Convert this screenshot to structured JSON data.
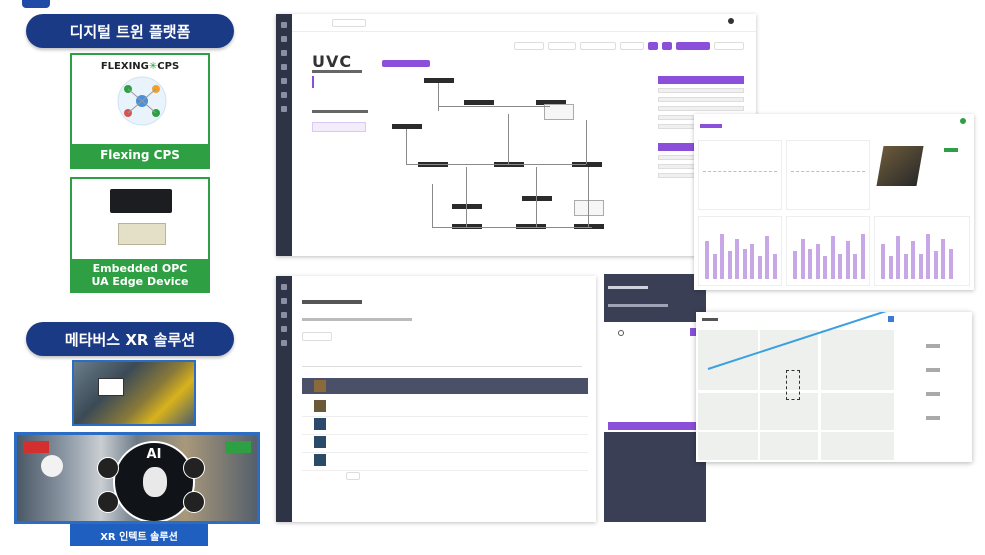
{
  "left": {
    "digital_twin_title": "디지털 트윈 플랫폼",
    "cps_logo_text": "FLEXING",
    "cps_logo_suffix": "CPS",
    "cps_caption": "Flexing CPS",
    "edge_caption_line1": "Embedded OPC",
    "edge_caption_line2": "UA Edge  Device",
    "metaverse_title": "메타버스 XR 솔루션",
    "xr_ai_label": "AI",
    "xr_caption": "XR 인텍트 솔루션"
  },
  "dashboard1": {
    "logo": "UVC"
  },
  "chart_window": {
    "bar_heights": [
      0.75,
      0.5,
      0.9,
      0.55,
      0.8,
      0.6,
      0.7,
      0.45,
      0.85,
      0.5
    ],
    "colors": {
      "bar": "#c8a7e6",
      "accent": "#8b4fd9",
      "status_ok": "#2ea043"
    }
  },
  "colors": {
    "pill": "#1b3a86",
    "green": "#2ea043",
    "purple": "#8b4fd9",
    "sidebar": "#2e3346"
  }
}
